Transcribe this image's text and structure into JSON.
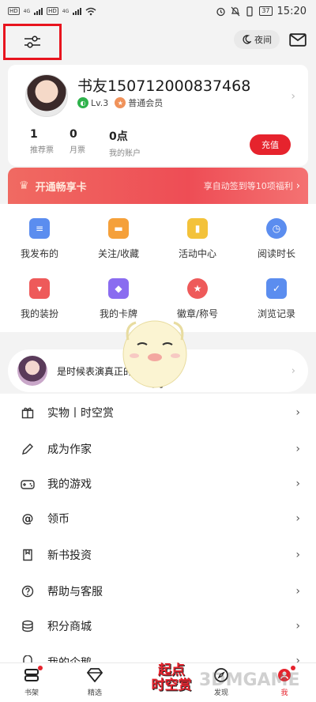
{
  "status_bar": {
    "left_tags": [
      "HD",
      "HD"
    ],
    "signal_text": "4G",
    "signal_text2": "4G",
    "battery": "37",
    "time": "15:20"
  },
  "topbar": {
    "night_label": "夜间",
    "icons": {
      "filter": "sliders-icon",
      "night": "moon-icon",
      "mail": "mail-icon"
    }
  },
  "profile": {
    "username": "书友150712000837468",
    "level": "Lv.3",
    "membership": "普通会员",
    "stats": [
      {
        "value": "1",
        "label": "推荐票"
      },
      {
        "value": "0",
        "label": "月票"
      },
      {
        "value": "0点",
        "label": "我的账户"
      }
    ],
    "recharge_label": "充值"
  },
  "vip_banner": {
    "title": "开通畅享卡",
    "desc": "享自动签到等10项福利"
  },
  "grid": {
    "items": [
      {
        "label": "我发布的",
        "icon": "message-icon",
        "color": "#5b8def"
      },
      {
        "label": "关注/收藏",
        "icon": "folder-icon",
        "color": "#f5a03a"
      },
      {
        "label": "活动中心",
        "icon": "gift-icon",
        "color": "#f3c23a"
      },
      {
        "label": "阅读时长",
        "icon": "clock-icon",
        "color": "#5b8def"
      },
      {
        "label": "我的装扮",
        "icon": "shirt-icon",
        "color": "#ee5a5a"
      },
      {
        "label": "我的卡牌",
        "icon": "card-icon",
        "color": "#8a6cf0"
      },
      {
        "label": "徽章/称号",
        "icon": "medal-icon",
        "color": "#ee5a5a"
      },
      {
        "label": "浏览记录",
        "icon": "history-icon",
        "color": "#5b8def"
      }
    ]
  },
  "promo": {
    "text": "是时候表演真正的技术了"
  },
  "menu": {
    "items": [
      {
        "label": "实物丨时空赏",
        "icon": "gift-box-icon"
      },
      {
        "label": "成为作家",
        "icon": "pen-icon"
      },
      {
        "label": "我的游戏",
        "icon": "gamepad-icon"
      },
      {
        "label": "领币",
        "icon": "at-coin-icon"
      },
      {
        "label": "新书投资",
        "icon": "book-icon"
      },
      {
        "label": "帮助与客服",
        "icon": "help-icon"
      },
      {
        "label": "积分商城",
        "icon": "coins-icon"
      },
      {
        "label": "我的企鹅",
        "icon": "penguin-icon"
      }
    ]
  },
  "bottom_nav": {
    "items": [
      {
        "label": "书架",
        "icon": "bookshelf-icon"
      },
      {
        "label": "精选",
        "icon": "diamond-icon"
      },
      {
        "label": "发现",
        "icon": "compass-icon"
      },
      {
        "label": "我",
        "icon": "profile-icon"
      }
    ],
    "center_logo": [
      "起点",
      "时空赏"
    ]
  },
  "watermark": "3DMGAME"
}
